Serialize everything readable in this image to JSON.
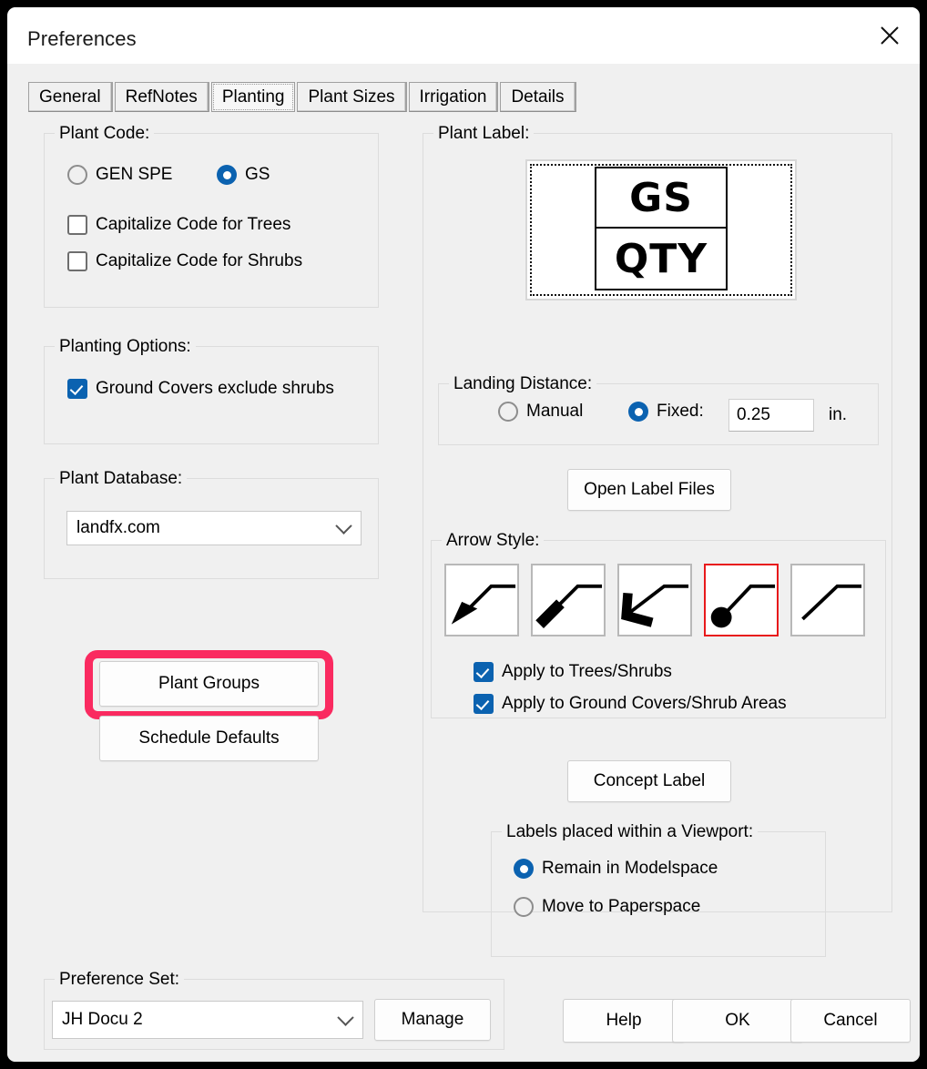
{
  "window": {
    "title": "Preferences",
    "close_icon": "close-x-icon"
  },
  "tabs": [
    {
      "label": "General",
      "active": false
    },
    {
      "label": "RefNotes",
      "active": false
    },
    {
      "label": "Planting",
      "active": true
    },
    {
      "label": "Plant Sizes",
      "active": false
    },
    {
      "label": "Irrigation",
      "active": false
    },
    {
      "label": "Details",
      "active": false
    }
  ],
  "plant_code": {
    "legend": "Plant Code:",
    "radios": [
      {
        "label": "GEN SPE",
        "checked": false
      },
      {
        "label": "GS",
        "checked": true
      }
    ],
    "checkboxes": [
      {
        "label": "Capitalize Code for Trees",
        "checked": false
      },
      {
        "label": "Capitalize Code for Shrubs",
        "checked": false
      }
    ]
  },
  "planting_options": {
    "legend": "Planting Options:",
    "checkboxes": [
      {
        "label": "Ground Covers exclude shrubs",
        "checked": true
      }
    ]
  },
  "plant_database": {
    "legend": "Plant Database:",
    "value": "landfx.com"
  },
  "left_buttons": {
    "plant_groups": "Plant Groups",
    "schedule_defaults": "Schedule Defaults",
    "highlight_color": "#fa2a60",
    "highlighted": "plant_groups"
  },
  "plant_label": {
    "legend": "Plant Label:",
    "preview": {
      "top_cell": "GS",
      "bottom_cell": "QTY"
    },
    "landing_distance": {
      "legend": "Landing Distance:",
      "manual": {
        "label": "Manual",
        "checked": false
      },
      "fixed": {
        "label": "Fixed:",
        "checked": true
      },
      "value": "0.25",
      "units": "in."
    },
    "open_label_files": "Open Label Files",
    "arrow_style": {
      "legend": "Arrow Style:",
      "options": [
        {
          "name": "solid-arrowhead",
          "selected": false
        },
        {
          "name": "thick-tick",
          "selected": false
        },
        {
          "name": "bent-open-arrow",
          "selected": false
        },
        {
          "name": "dot-terminator",
          "selected": true
        },
        {
          "name": "plain-line",
          "selected": false
        }
      ],
      "checkboxes": [
        {
          "label": "Apply to Trees/Shrubs",
          "checked": true
        },
        {
          "label": "Apply to Ground Covers/Shrub Areas",
          "checked": true
        }
      ]
    },
    "concept_label": "Concept Label",
    "viewport": {
      "legend": "Labels placed within a Viewport:",
      "radios": [
        {
          "label": "Remain in Modelspace",
          "checked": true
        },
        {
          "label": "Move to Paperspace",
          "checked": false
        }
      ]
    }
  },
  "preference_set": {
    "legend": "Preference Set:",
    "value": "JH Docu 2",
    "manage": "Manage"
  },
  "footer_buttons": {
    "help": "Help",
    "ok": "OK",
    "cancel": "Cancel"
  },
  "accent_color": "#0b62b0"
}
